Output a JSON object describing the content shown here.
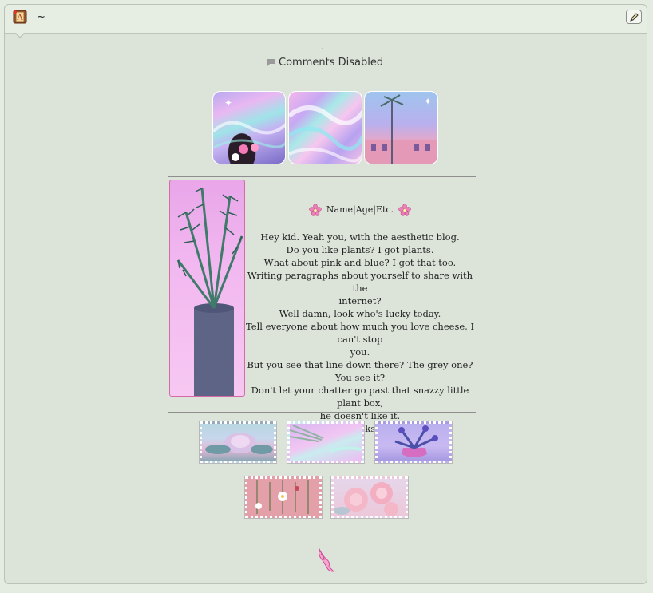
{
  "header": {
    "title": "~",
    "edit_icon": "pencil-icon",
    "app_icon": "book-icon"
  },
  "post": {
    "separator_dot": ".",
    "comments_label": "Comments Disabled",
    "comments_icon": "speech-bubble-icon"
  },
  "bio": {
    "title": "Name|Age|Etc.",
    "flower_icon": "cherry-blossom-icon",
    "lines": [
      "Hey kid. Yeah you, with the aesthetic blog.",
      "Do you like plants? I got plants.",
      "What about pink and blue? I got that too.",
      "Writing paragraphs about yourself to share with the",
      "internet?",
      "Well damn, look who's lucky today.",
      "Tell everyone about how much you love cheese, I can't stop",
      "you.",
      "But you see that line down there? The grey one? You see it?",
      "Don't let your chatter go past that snazzy little plant box,",
      "he doesn't like it.",
      "Thanks."
    ]
  },
  "colors": {
    "background": "#dce4d9",
    "accent_pink": "#e26aa8",
    "divider": "#8e8e8e"
  },
  "footer": {
    "bird_icon": "pink-bird-icon"
  }
}
